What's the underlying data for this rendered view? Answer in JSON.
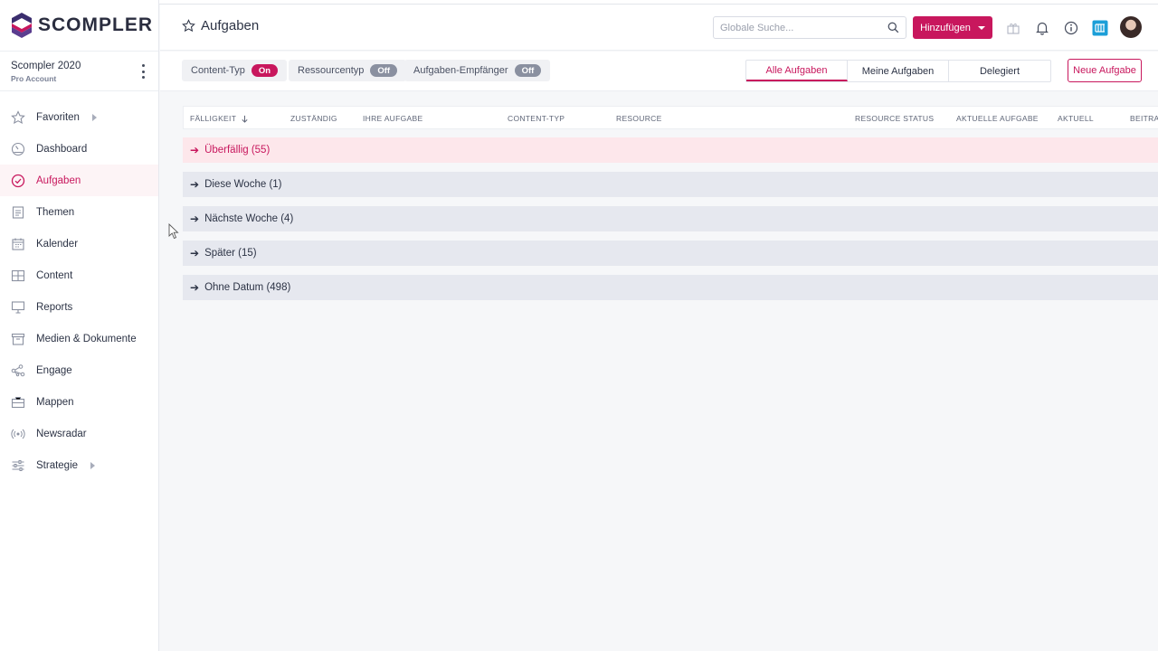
{
  "brand": {
    "name": "SCOMPLER",
    "accent": "#c8175d"
  },
  "account": {
    "name": "Scompler 2020",
    "plan": "Pro Account"
  },
  "sidebar": {
    "items": [
      {
        "label": "Favoriten",
        "icon": "star-icon",
        "has_submenu": true
      },
      {
        "label": "Dashboard",
        "icon": "gauge-icon"
      },
      {
        "label": "Aufgaben",
        "icon": "check-circle-icon",
        "active": true
      },
      {
        "label": "Themen",
        "icon": "document-icon"
      },
      {
        "label": "Kalender",
        "icon": "calendar-icon"
      },
      {
        "label": "Content",
        "icon": "grid-icon"
      },
      {
        "label": "Reports",
        "icon": "presentation-icon"
      },
      {
        "label": "Medien & Dokumente",
        "icon": "archive-icon"
      },
      {
        "label": "Engage",
        "icon": "network-icon"
      },
      {
        "label": "Mappen",
        "icon": "briefcase-icon"
      },
      {
        "label": "Newsradar",
        "icon": "radar-icon"
      },
      {
        "label": "Strategie",
        "icon": "sliders-icon",
        "has_submenu": true
      }
    ]
  },
  "header": {
    "title": "Aufgaben",
    "search_placeholder": "Globale Suche...",
    "add_label": "Hinzufügen"
  },
  "filters": {
    "chips": [
      {
        "label": "Content-Typ",
        "state": "On"
      },
      {
        "label": "Ressourcentyp",
        "state": "Off"
      },
      {
        "label": "Aufgaben-Empfänger",
        "state": "Off"
      }
    ],
    "tabs": [
      {
        "label": "Alle Aufgaben",
        "active": true
      },
      {
        "label": "Meine Aufgaben"
      },
      {
        "label": "Delegiert"
      }
    ],
    "new_task_label": "Neue Aufgabe"
  },
  "table": {
    "columns": [
      "FÄLLIGKEIT",
      "ZUSTÄNDIG",
      "IHRE AUFGABE",
      "CONTENT-TYP",
      "RESOURCE",
      "RESOURCE STATUS",
      "AKTUELLE AUFGABE",
      "AKTUELL",
      "BEITRAG"
    ],
    "groups": [
      {
        "label": "Überfällig (55)",
        "overdue": true
      },
      {
        "label": "Diese Woche (1)"
      },
      {
        "label": "Nächste Woche (4)"
      },
      {
        "label": "Später (15)"
      },
      {
        "label": "Ohne Datum (498)"
      }
    ]
  }
}
